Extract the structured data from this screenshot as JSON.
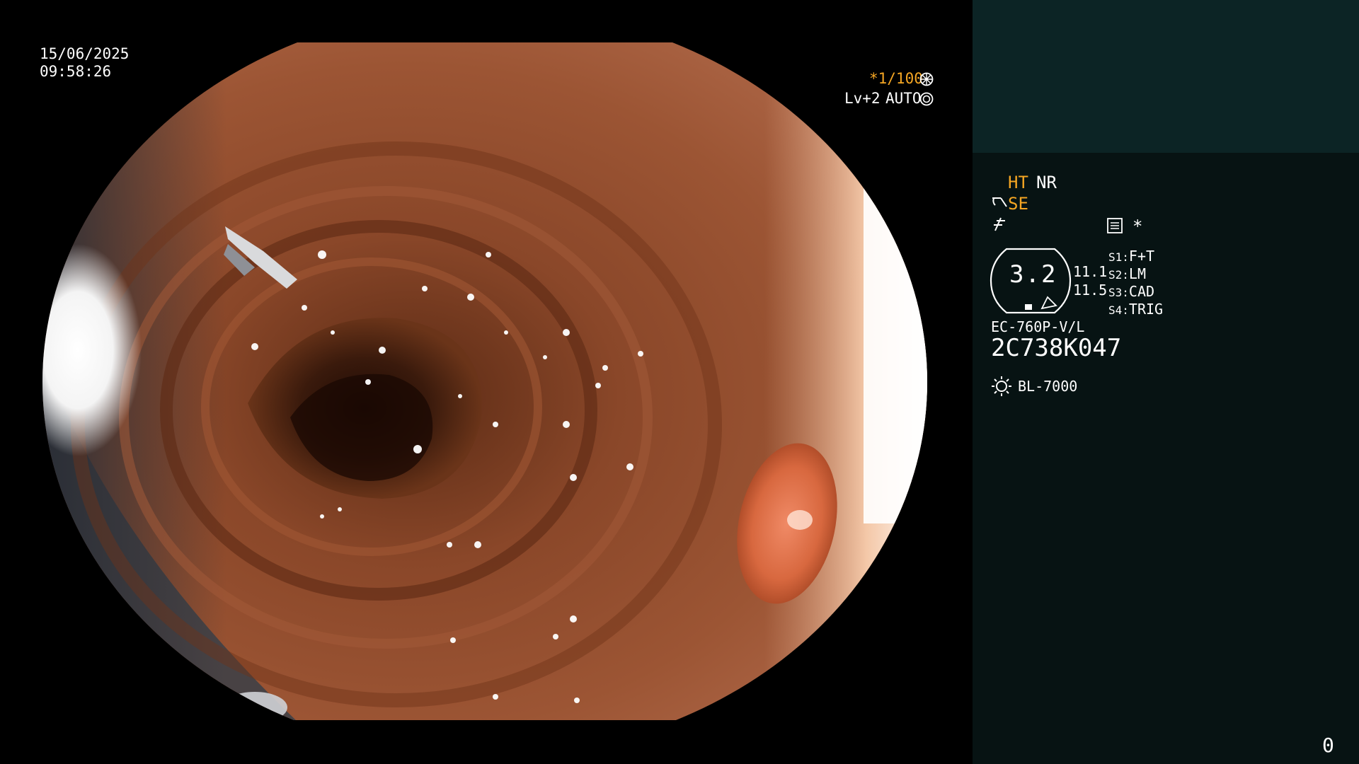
{
  "overlay": {
    "date": "15/06/2025",
    "time": "09:58:26",
    "shutter": "*1/100",
    "level": "Lv+2",
    "mode": "AUTO"
  },
  "panel": {
    "ht": "HT",
    "nr": "NR",
    "se": "SE",
    "star": "*",
    "zoom_value": "3.2",
    "value_1": "11.1",
    "value_2": "11.5",
    "settings": [
      {
        "key": "S1:",
        "value": "F+T"
      },
      {
        "key": "S2:",
        "value": "LM"
      },
      {
        "key": "S3:",
        "value": "CAD"
      },
      {
        "key": "S4:",
        "value": "TRIG"
      }
    ],
    "model": "EC-760P-V/L",
    "serial": "2C738K047",
    "light_source": "BL-7000",
    "page_number": "0"
  },
  "colors": {
    "accent_orange": "#f5a623",
    "panel_bg": "#071313",
    "panel_top_bg": "#0c2425",
    "mucosa": "#8a4a2c"
  },
  "icons": [
    "shutter-icon",
    "iris-icon",
    "scope-icon",
    "freeze-icon",
    "menu-icon",
    "lamp-icon"
  ]
}
